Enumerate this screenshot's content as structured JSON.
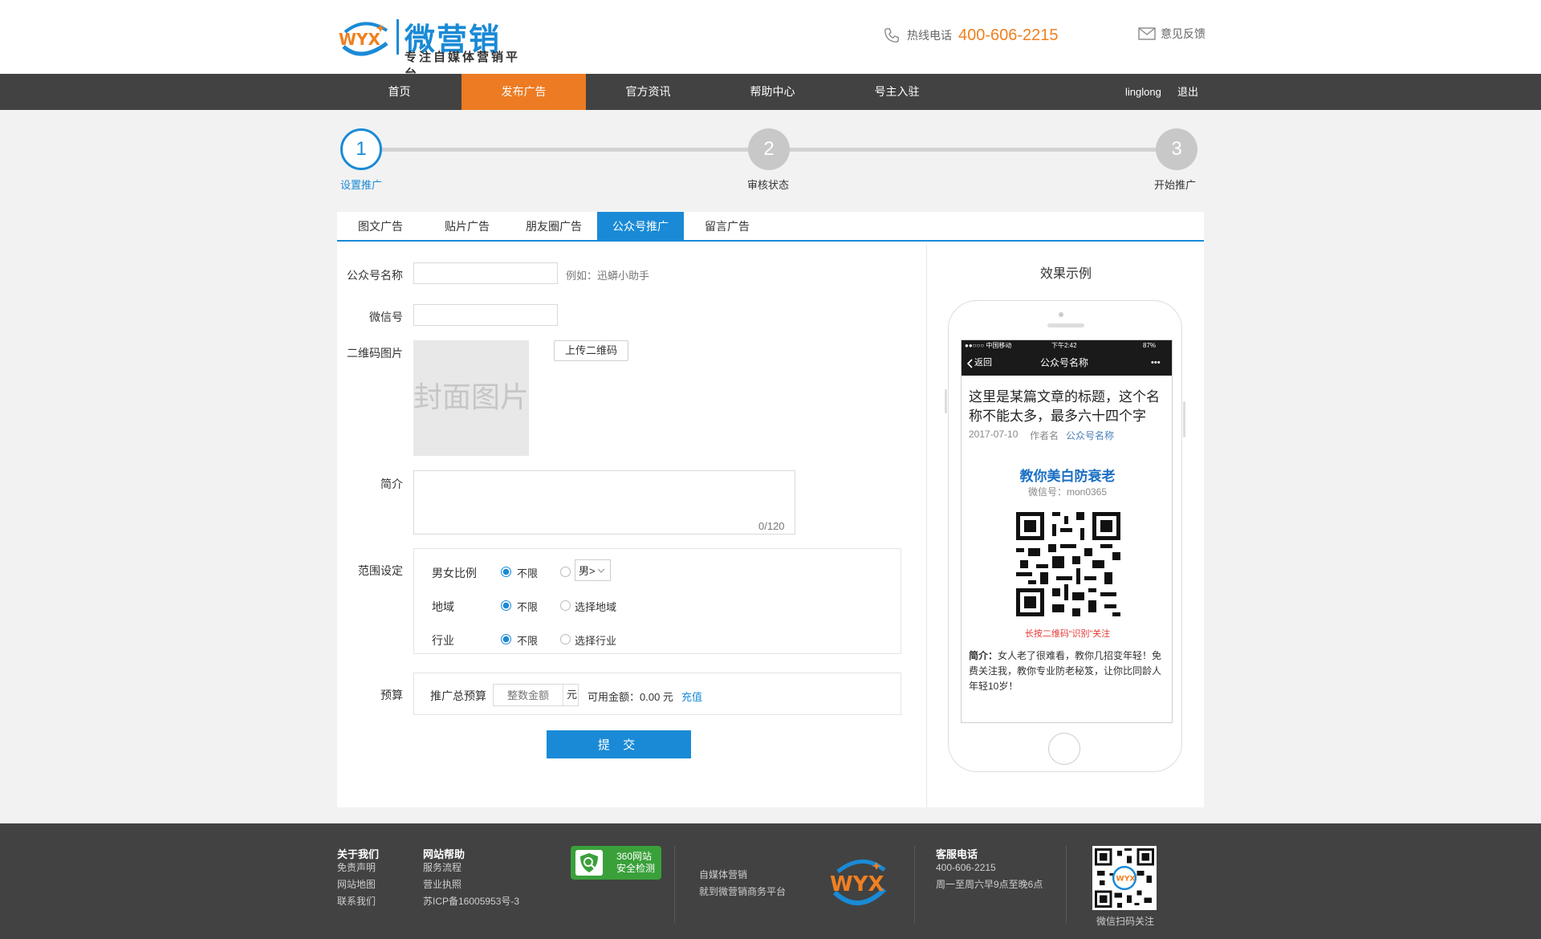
{
  "header": {
    "logo_mark": "WYX",
    "logo_title": "微营销",
    "logo_slogan": "专注自媒体营销平台",
    "hotline_label": "热线电话",
    "hotline_number": "400-606-2215",
    "feedback_label": "意见反馈"
  },
  "nav": {
    "items": [
      {
        "label": "首页"
      },
      {
        "label": "发布广告"
      },
      {
        "label": "官方资讯"
      },
      {
        "label": "帮助中心"
      },
      {
        "label": "号主入驻"
      }
    ],
    "active_index": 1,
    "username": "linglong",
    "logout": "退出"
  },
  "steps": [
    {
      "number": "1",
      "label": "设置推广",
      "active": true
    },
    {
      "number": "2",
      "label": "审核状态",
      "active": false
    },
    {
      "number": "3",
      "label": "开始推广",
      "active": false
    }
  ],
  "tabs": [
    {
      "label": "图文广告"
    },
    {
      "label": "贴片广告"
    },
    {
      "label": "朋友圈广告"
    },
    {
      "label": "公众号推广"
    },
    {
      "label": "留言广告"
    }
  ],
  "active_tab": 3,
  "form": {
    "account_name_label": "公众号名称",
    "account_name_value": "",
    "account_name_hint": "例如：迅蟒小助手",
    "wechat_id_label": "微信号",
    "wechat_id_value": "",
    "qrcode_label": "二维码图片",
    "qrcode_placeholder": "封面图片",
    "upload_button": "上传二维码",
    "intro_label": "简介",
    "intro_value": "",
    "intro_counter": "0/120",
    "scope_label": "范围设定",
    "scope": {
      "gender_label": "男女比例",
      "gender_unlimited": "不限",
      "gender_select": "男>",
      "region_label": "地域",
      "region_unlimited": "不限",
      "region_select": "选择地域",
      "industry_label": "行业",
      "industry_unlimited": "不限",
      "industry_select": "选择行业"
    },
    "budget_label": "预算",
    "budget_total_label": "推广总预算",
    "budget_placeholder": "整数金额",
    "budget_unit": "元",
    "available_text": "可用金额：0.00 元",
    "recharge": "充值",
    "submit": "提 交"
  },
  "preview": {
    "title": "效果示例",
    "status_left": "●●○○○ 中国移动 ",
    "status_time": "下午2:42",
    "status_right": "87%",
    "back": "返回",
    "nav_title": "公众号名称",
    "more": "•••",
    "article_title": "这里是某篇文章的标题，这个名称不能太多，最多六十四个字",
    "article_date": "2017-07-10",
    "article_author": "作者名",
    "article_account": "公众号名称",
    "account_display": "教你美白防衰老",
    "wechat_id": "微信号：mon0365",
    "scan_tip": "长按二维码“识别”关注",
    "intro_label": "简介：",
    "intro_text": "女人老了很难看，教你几招变年轻！免费关注我，教你专业防老秘笈，让你比同龄人年轻10岁！"
  },
  "footer": {
    "about_title": "关于我们",
    "about_links": [
      "免责声明",
      "网站地图",
      "联系我们"
    ],
    "help_title": "网站帮助",
    "help_links": [
      "服务流程",
      "营业执照",
      "苏ICP备16005953号-3"
    ],
    "badge_line1": "360网站",
    "badge_line2": "安全检测",
    "mid_text1": "自媒体营销",
    "mid_text2": "就到微营销商务平台",
    "footer_logo": "WYX",
    "service_title": "客服电话",
    "service_phone": "400-606-2215",
    "service_hours": "周一至周六早9点至晚6点",
    "qr_caption": "微信扫码关注"
  },
  "colors": {
    "brand_blue": "#1a8ad6",
    "brand_orange": "#ed7b23",
    "nav_bg": "#424242",
    "page_bg": "#f2f2f2"
  },
  "icons": [
    "phone-icon",
    "mail-icon",
    "chevron-left-icon",
    "chevron-down-icon",
    "shield-icon"
  ]
}
